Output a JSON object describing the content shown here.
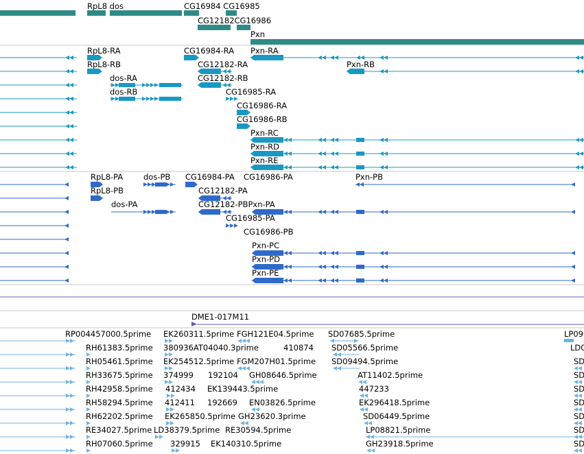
{
  "colors": {
    "gene": "#2e8b87",
    "transcript": "#1a98c4",
    "protein": "#2f6ac9",
    "contig": "#6a57b9",
    "est": "#6fb3e0",
    "divider": "#c8c8c8"
  },
  "genes": [
    "RpL8",
    "dos",
    "CG16984",
    "CG16985",
    "CG12182",
    "CG16986",
    "Pxn"
  ],
  "transcripts": [
    "RpL8-RA",
    "RpL8-RB",
    "dos-RA",
    "dos-RB",
    "CG16984-RA",
    "CG12182-RA",
    "CG12182-RB",
    "CG16985-RA",
    "CG16986-RA",
    "CG16986-RB",
    "Pxn-RA",
    "Pxn-RB",
    "Pxn-RC",
    "Pxn-RD",
    "Pxn-RE"
  ],
  "proteins": [
    "RpL8-PA",
    "RpL8-PB",
    "dos-PB",
    "dos-PA",
    "CG16984-PA",
    "CG16986-PA",
    "CG12182-PA",
    "CG12182-PB",
    "Pxn-PA",
    "CG16985-PA",
    "CG16986-PB",
    "Pxn-PB",
    "Pxn-PC",
    "Pxn-PD",
    "Pxn-PE"
  ],
  "contig": "DME1-017M11",
  "ests": [
    "RP004457000.5prime",
    "RH61383.5prime",
    "RH05461.5prime",
    "RH33675.5prime",
    "RH42958.5prime",
    "RH58294.5prime",
    "RH62202.5prime",
    "RE34027.5prime",
    "RH07060.5prime",
    "EK260311.5prime",
    "380936",
    "EK254512.5prime",
    "374999",
    "412434",
    "412411",
    "EK265850.5prime",
    "LD38379.5prime",
    "329915",
    "AT04040.3prime",
    "192104",
    "EK139443.5prime",
    "192669",
    "RE30594.5prime",
    "EK140310.5prime",
    "FGH121E04.5prime",
    "410874",
    "FGM207H01.5prime",
    "GH08646.5prime",
    "EN03826.5prime",
    "GH23620.3prime",
    "SD07685.5prime",
    "SD05566.5prime",
    "SD09494.5prime",
    "AT11402.5prime",
    "447233",
    "EK296418.5prime",
    "SD06449.5prime",
    "LP08821.5prime",
    "GH23918.5prime",
    "LP09",
    "LD0",
    "SD"
  ]
}
